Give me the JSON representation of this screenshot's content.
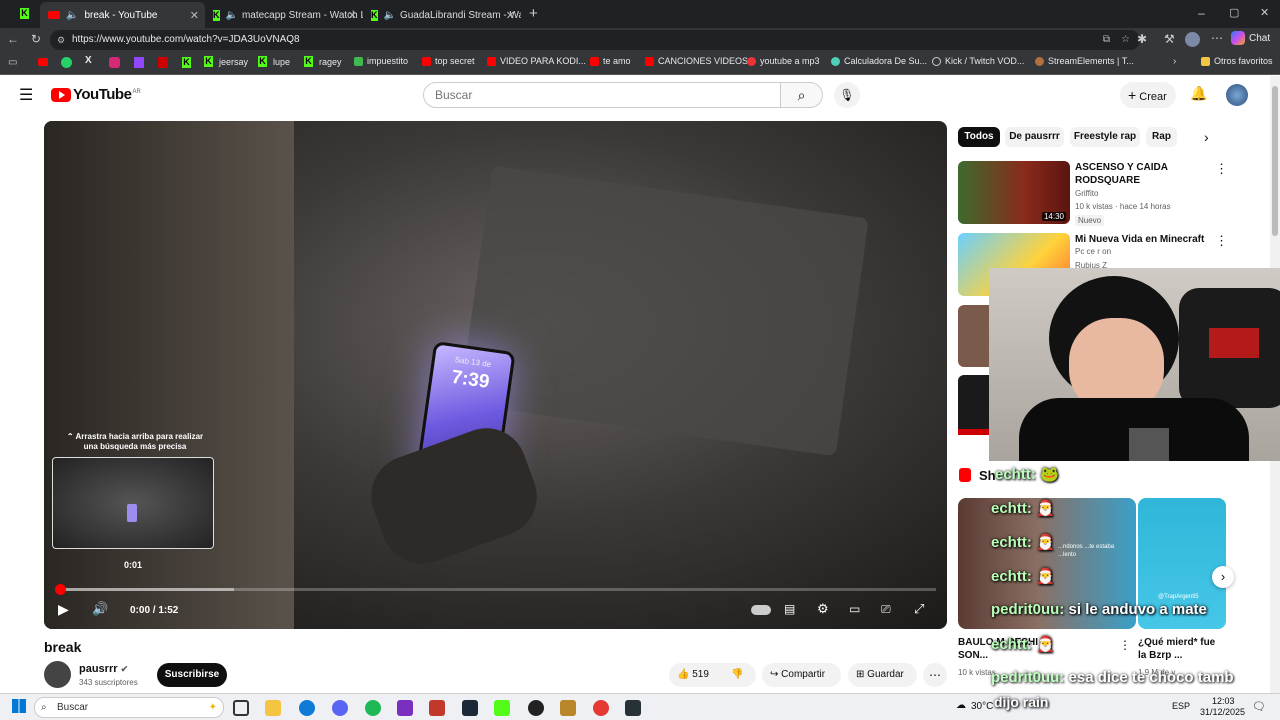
{
  "tabs": [
    {
      "title": "break - YouTube",
      "active": true
    },
    {
      "title": "matecapp Stream - Watch Liv",
      "active": false
    },
    {
      "title": "GuadaLibrandi Stream - Watc",
      "active": false
    }
  ],
  "url": "https://www.youtube.com/watch?v=JDA3UoVNAQ8",
  "chat_label": "Chat",
  "bookmarks": [
    "jeersay",
    "lupe",
    "ragey",
    "impuestito",
    "top secret",
    "VIDEO PARA KODI...",
    "te amo",
    "CANCIONES VIDEOS",
    "youtube a mp3",
    "Calculadora De Su...",
    "Kick / Twitch VOD...",
    "StreamElements | T...",
    "Otros favoritos"
  ],
  "yt": {
    "logo": "YouTube",
    "region": "AR",
    "search_placeholder": "Buscar",
    "create_label": "Crear"
  },
  "player": {
    "drag_hint": "Arrastra hacia arriba para realizar una búsqueda más precisa",
    "preview_time": "0:01",
    "time": "0:00 / 1:52",
    "phone_time": "7:39",
    "progress": 0.0
  },
  "video": {
    "title": "break",
    "channel": "pausrrr",
    "subs": "343 suscriptores",
    "subscribe": "Suscribirse",
    "likes": "519",
    "share": "Compartir",
    "save": "Guardar"
  },
  "chips": [
    "Todos",
    "De pausrrr",
    "Freestyle rap",
    "Rap"
  ],
  "recs": [
    {
      "title": "ASCENSO Y CAIDA RODSQUARE",
      "channel": "Griffito",
      "meta": "10 k vistas · hace 14 horas",
      "badge": "Nuevo",
      "duration": "14:30"
    },
    {
      "title": "Mi Nueva Vida en Minecraft",
      "subtitle": "Pc ce r on",
      "channel": "Rubius Z"
    }
  ],
  "shorts_label": "Sh",
  "shorts": [
    {
      "title": "BAULO M DESHI SON...",
      "meta": "10 k vistas"
    },
    {
      "title": "¿Qué mierd* fue la Bzrp ...",
      "meta": "1,9 M de v"
    }
  ],
  "short_captions": [
    "@TrapArgenti5",
    "...ndonos ...te estaba ...lento"
  ],
  "chat": [
    {
      "user": "echtt:",
      "msg": ""
    },
    {
      "user": "echtt:",
      "msg": ""
    },
    {
      "user": "echtt:",
      "msg": ""
    },
    {
      "user": "echtt:",
      "msg": ""
    },
    {
      "user": "pedrit0uu:",
      "msg": "si le anduvo a mate"
    },
    {
      "user": "echtt:",
      "msg": ""
    },
    {
      "user": "pedrit0uu:",
      "msg": "esa dice te choco tamb"
    },
    {
      "user": "",
      "msg": "dijo rain"
    }
  ],
  "taskbar": {
    "search": "Buscar",
    "weather": "30°C",
    "lang": "ESP",
    "time": "12:03",
    "date": "31/12/2025"
  }
}
